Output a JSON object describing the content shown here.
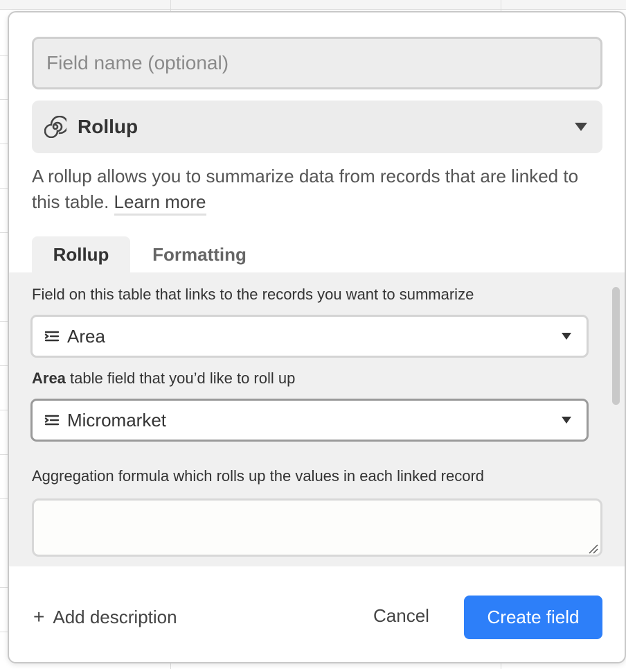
{
  "dialog": {
    "name_placeholder": "Field name (optional)",
    "type": {
      "label": "Rollup",
      "icon": "rollup-spiral-icon"
    },
    "description": "A rollup allows you to summarize data from records that are linked to this table.",
    "learn_more": "Learn more",
    "tabs": [
      {
        "label": "Rollup",
        "active": true
      },
      {
        "label": "Formatting",
        "active": false
      }
    ],
    "link_field": {
      "label": "Field on this table that links to the records you want to summarize",
      "value": "Area"
    },
    "rollup_field": {
      "label_bold": "Area",
      "label_rest": " table field that you’d like to roll up",
      "value": "Micromarket"
    },
    "aggregation": {
      "label": "Aggregation formula which rolls up the values in each linked record",
      "value": ""
    },
    "footer": {
      "add_description": "Add description",
      "cancel": "Cancel",
      "create": "Create field"
    },
    "colors": {
      "accent": "#2d7ff9",
      "panel_bg": "#f0f0f0"
    }
  }
}
